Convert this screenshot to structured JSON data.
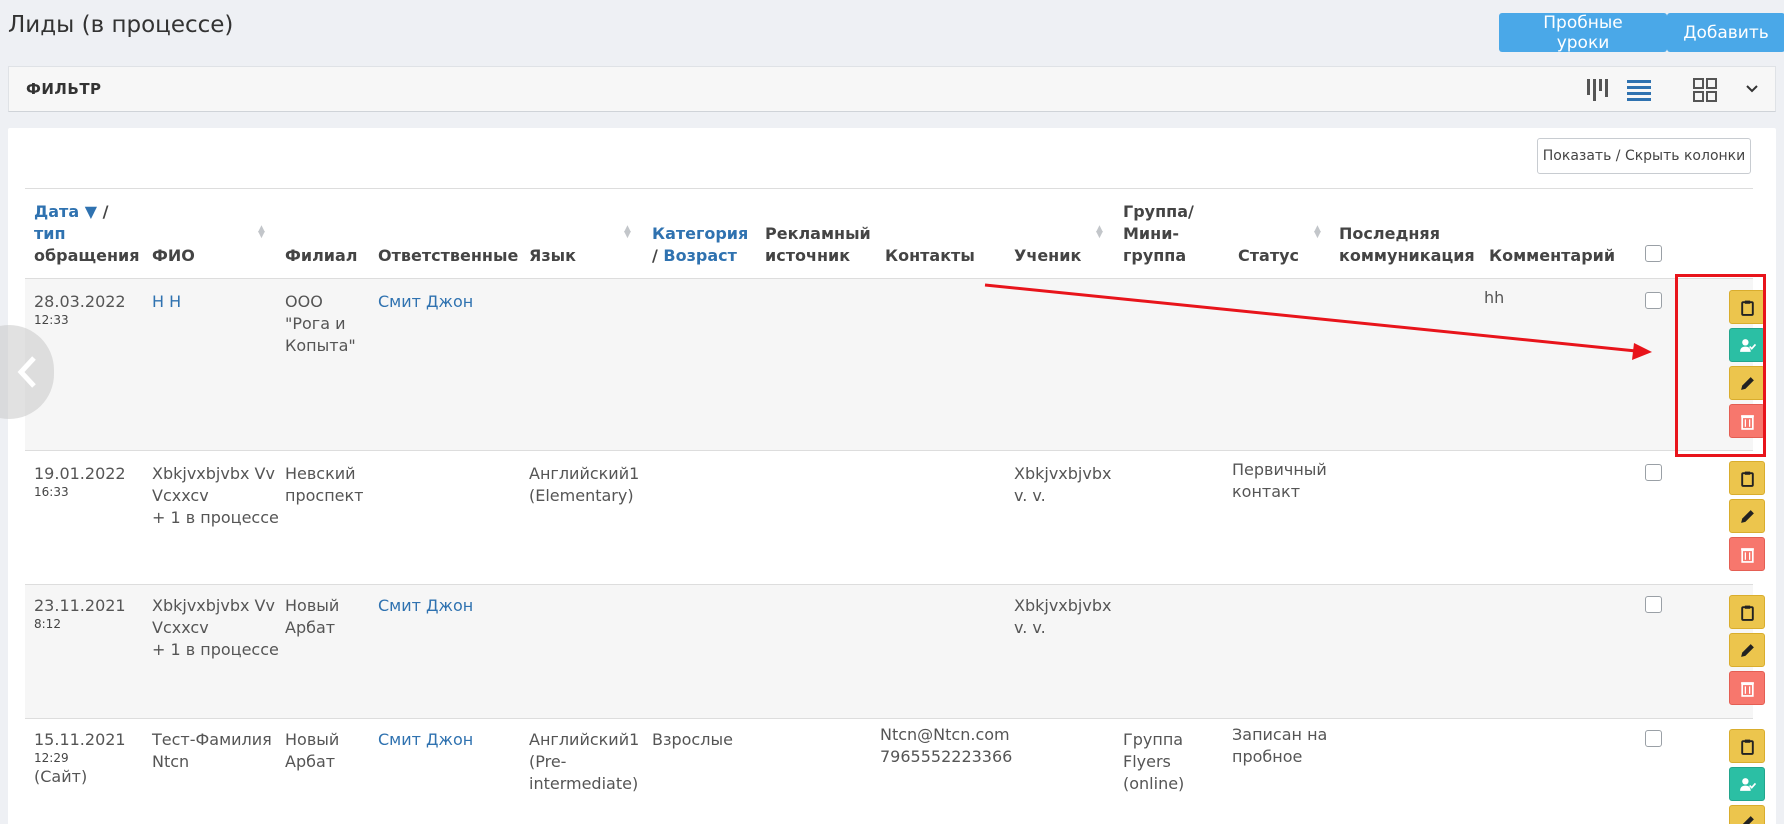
{
  "page": {
    "title": "Лиды (в процессе)",
    "trial_button": "Пробные уроки",
    "add_button": "Добавить"
  },
  "filter": {
    "label": "ФИЛЬТР"
  },
  "toolbar": {
    "columns_button": "Показать / Скрыть колонки"
  },
  "table": {
    "headers": {
      "date_link": "Дата",
      "date_sort_indicator": "▼",
      "date_slash": "/",
      "date_rest_1": "тип",
      "date_rest_2": "обращения",
      "fio": "ФИО",
      "branch": "Филиал",
      "responsible": "Ответственные",
      "language": "Язык",
      "category_1": "Категория",
      "category_2_slash": "/",
      "category_2": "Возраст",
      "ad_source_1": "Рекламный",
      "ad_source_2": "источник",
      "contacts": "Контакты",
      "student": "Ученик",
      "group_1": "Группа/",
      "group_2": "Мини-",
      "group_3": "группа",
      "status": "Статус",
      "last_comm_1": "Последняя",
      "last_comm_2": "коммуникация",
      "comment": "Комментарий"
    },
    "rows": [
      {
        "date": "28.03.2022",
        "time": "12:33",
        "fio": "Н Н",
        "branch_1": "ООО",
        "branch_2": "\"Рога и",
        "branch_3": "Копыта\"",
        "responsible": "Смит Джон",
        "comment": "hh"
      },
      {
        "date": "19.01.2022",
        "time": "16:33",
        "fio_1": "Xbkjvxbjvbx Vv",
        "fio_2": "Vcxxcv",
        "fio_extra": "+ 1 в процессе",
        "branch_1": "Невский",
        "branch_2": "проспект",
        "language_1": "Английский1",
        "language_2": "(Elementary)",
        "student_1": "Xbkjvxbjvbx",
        "student_2": "v. v.",
        "status_1": "Первичный",
        "status_2": "контакт"
      },
      {
        "date": "23.11.2021",
        "time": "8:12",
        "fio_1": "Xbkjvxbjvbx Vv",
        "fio_2": "Vcxxcv",
        "fio_extra": "+ 1 в процессе",
        "branch_1": "Новый",
        "branch_2": "Арбат",
        "responsible": "Смит Джон",
        "student_1": "Xbkjvxbjvbx",
        "student_2": "v. v."
      },
      {
        "date": "15.11.2021",
        "time": "12:29",
        "type": "(Сайт)",
        "fio_1": "Тест-Фамилия",
        "fio_2": "Ntcn",
        "branch_1": "Новый",
        "branch_2": "Арбат",
        "responsible": "Смит Джон",
        "language_1": "Английский1",
        "language_2": "(Pre-",
        "language_3": "intermediate)",
        "category": "Взрослые",
        "contact_email": "Ntcn@Ntcn.com",
        "contact_phone": "7965552223366",
        "group_1": "Группа",
        "group_2": "Flyers",
        "group_3": "(online)",
        "status_1": "Записан на",
        "status_2": "пробное"
      }
    ]
  },
  "colors": {
    "primary_button": "#4aa8e8",
    "link": "#2f72b0",
    "action_yellow": "#ecc54d",
    "action_green": "#2bbfa4",
    "action_red": "#f7776d",
    "annotation_red": "#e8141b"
  },
  "icons": {
    "view_kanban": "kanban-view-icon",
    "view_list": "list-view-icon",
    "view_grid": "grid-view-icon",
    "dropdown": "chevron-down-icon",
    "prev": "chevron-left-icon",
    "action_copy": "clipboard-icon",
    "action_convert": "user-check-icon",
    "action_edit": "pencil-icon",
    "action_delete": "trash-icon"
  }
}
